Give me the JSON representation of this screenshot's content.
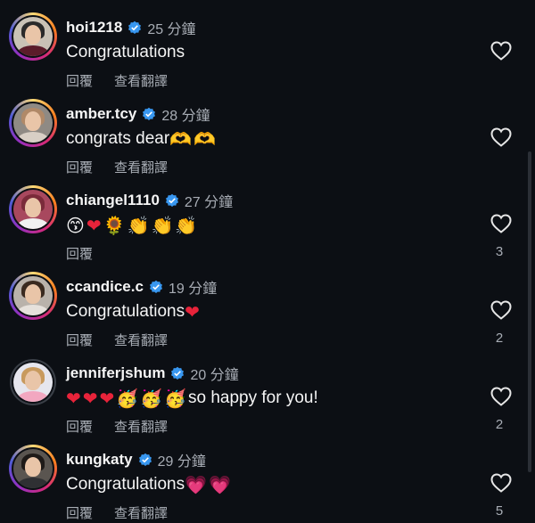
{
  "comments": [
    {
      "username": "hoi1218",
      "time": "25 分鐘",
      "text": "Congratulations",
      "emojis": [],
      "reply_label": "回覆",
      "translate_label": "查看翻譯",
      "likes": "",
      "avatar_colors": {
        "hair": "#2a2a2a",
        "body": "#5b1c2a",
        "bg": "#c9c2b6"
      },
      "ring": true
    },
    {
      "username": "amber.tcy",
      "time": "28 分鐘",
      "text": "congrats dear",
      "emojis": [
        "🫶",
        "🫶"
      ],
      "reply_label": "回覆",
      "translate_label": "查看翻譯",
      "likes": "",
      "avatar_colors": {
        "hair": "#b08968",
        "body": "#d8cfc5",
        "bg": "#8f8a84"
      },
      "ring": true
    },
    {
      "username": "chiangel1110",
      "time": "27 分鐘",
      "text": "",
      "emojis": [
        "😙",
        "❤",
        "🌻",
        "👏",
        "👏",
        "👏"
      ],
      "reply_label": "回覆",
      "translate_label": "",
      "likes": "3",
      "avatar_colors": {
        "hair": "#7a2b3a",
        "body": "#f1f1f1",
        "bg": "#a8485e"
      },
      "ring": true
    },
    {
      "username": "ccandice.c",
      "time": "19 分鐘",
      "text": "Congratulations ",
      "emojis": [
        "❤"
      ],
      "reply_label": "回覆",
      "translate_label": "查看翻譯",
      "likes": "2",
      "avatar_colors": {
        "hair": "#3a2a20",
        "body": "#e6e1dc",
        "bg": "#b9b2ab"
      },
      "ring": true
    },
    {
      "username": "jenniferjshum",
      "time": "20 分鐘",
      "text": "so happy for you!",
      "emojis": [
        "❤",
        "❤",
        "❤",
        "🥳",
        "🥳",
        "🥳"
      ],
      "reply_label": "回覆",
      "translate_label": "查看翻譯",
      "likes": "2",
      "avatar_colors": {
        "hair": "#c89a5e",
        "body": "#f2a7c0",
        "bg": "#e6e6ee"
      },
      "ring": false
    },
    {
      "username": "kungkaty",
      "time": "29 分鐘",
      "text": "Congratulations ",
      "emojis": [
        "💗",
        "💗"
      ],
      "reply_label": "回覆",
      "translate_label": "查看翻譯",
      "likes": "5",
      "avatar_colors": {
        "hair": "#1e1a18",
        "body": "#2f3033",
        "bg": "#5a5550"
      },
      "ring": true
    }
  ],
  "colors": {
    "background": "#0c0f14",
    "verified": "#3897f0",
    "muted": "#a8adb5",
    "heart_red": "#e8233a",
    "heart_pink": "#f0379a"
  }
}
